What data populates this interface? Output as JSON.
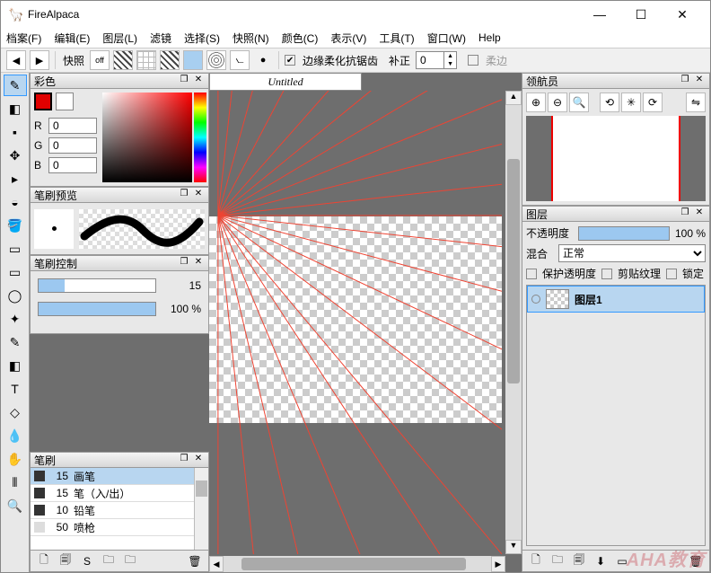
{
  "app": {
    "title": "FireAlpaca"
  },
  "win_btns": {
    "min": "—",
    "max": "☐",
    "close": "✕"
  },
  "menu": {
    "file": "档案(F)",
    "edit": "编辑(E)",
    "layer": "图层(L)",
    "filter": "滤镜",
    "select": "选择(S)",
    "snap": "快照(N)",
    "color": "颜色(C)",
    "view": "表示(V)",
    "tool": "工具(T)",
    "window": "窗口(W)",
    "help": "Help"
  },
  "toolbar": {
    "nav_prev": "◀",
    "nav_next": "▶",
    "snap_label": "快照",
    "off": "off",
    "aa_label": "边缘柔化抗锯齿",
    "aa_check": "✔",
    "correct_label": "补正",
    "correct_val": "0",
    "soft_label": "柔边",
    "dot": "●",
    "curve": "⦦"
  },
  "tools": {
    "brush": "✎",
    "eraser": "◧",
    "dot": "▪",
    "move": "✥",
    "movep": "▸",
    "fill": "◒",
    "bucket": "🪣",
    "grad": "▭",
    "selrect": "▭",
    "wand": "✦",
    "selpen": "✎",
    "lasso": "◯",
    "text": "T",
    "eyedrop": "💧",
    "hand": "✋",
    "shape": "◇",
    "split": "⫴",
    "zoom": "🔍"
  },
  "panels": {
    "color_title": "彩色",
    "preview_title": "笔刷预览",
    "control_title": "笔刷控制",
    "brush_title": "笔刷",
    "navigator_title": "领航员",
    "layer_title": "图层",
    "dock": "❐",
    "close": "✕"
  },
  "color": {
    "r_label": "R",
    "g_label": "G",
    "b_label": "B",
    "r": "0",
    "g": "0",
    "b": "0"
  },
  "brush_ctrl": {
    "size_val": "15",
    "opacity_val": "100 %"
  },
  "brushes": [
    {
      "size": "15",
      "name": "画笔"
    },
    {
      "size": "15",
      "name": "笔（入/出）"
    },
    {
      "size": "10",
      "name": "铅笔"
    },
    {
      "size": "50",
      "name": "喷枪"
    }
  ],
  "brush_actions": {
    "new": "🗋",
    "dup": "🗐",
    "script": "S",
    "folder": "🗀",
    "folder2": "🗀",
    "trash": "🗑"
  },
  "doc": {
    "tab": "Untitled"
  },
  "navigator": {
    "zoomin": "⊕",
    "zoomout": "⊖",
    "fit": "🔍",
    "rot_ccw": "⟲",
    "reset": "✳",
    "rot_cw": "⟳",
    "flip": "⇋"
  },
  "layer": {
    "opacity_label": "不透明度",
    "opacity_val": "100 %",
    "blend_label": "混合",
    "blend_val": "正常",
    "protect_label": "保护透明度",
    "clip_label": "剪贴纹理",
    "lock_label": "锁定",
    "layer1_name": "图层1"
  },
  "layer_actions": {
    "new": "🗋",
    "folder": "🗀",
    "dup": "🗐",
    "merge": "⬇",
    "clear": "▭",
    "trash": "🗑"
  },
  "watermark": "AHA教育"
}
